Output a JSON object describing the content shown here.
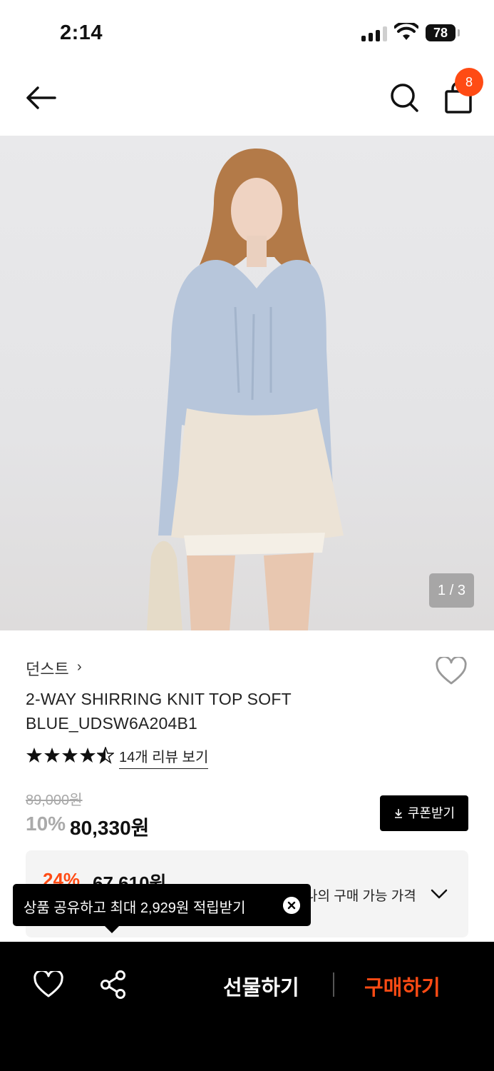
{
  "status_bar": {
    "time": "2:14",
    "battery": "78"
  },
  "nav": {
    "cart_count": "8",
    "icons": [
      "back-arrow-icon",
      "search-icon",
      "shopping-bag-icon"
    ]
  },
  "gallery": {
    "counter": "1 / 3"
  },
  "product": {
    "brand": "던스트",
    "brand_chevron": "›",
    "name": "2-WAY SHIRRING KNIT TOP SOFT BLUE_UDSW6A204B1",
    "rating": 4.5,
    "rating_max": 5,
    "review_link": "14개 리뷰 보기",
    "original_price": "89,000원",
    "discount_rate": "10%",
    "sale_price": "80,330원",
    "coupon_label": "쿠폰받기"
  },
  "best_price": {
    "rate": "24%",
    "price": "67,610원",
    "label": "나의 구매 가능 가격"
  },
  "tooltip": {
    "text": "상품 공유하고 최대 2,929원 적립받기"
  },
  "bottom_bar": {
    "gift_label": "선물하기",
    "buy_label": "구매하기"
  },
  "colors": {
    "accent": "#ff4b14",
    "bar_bg": "#000000"
  }
}
